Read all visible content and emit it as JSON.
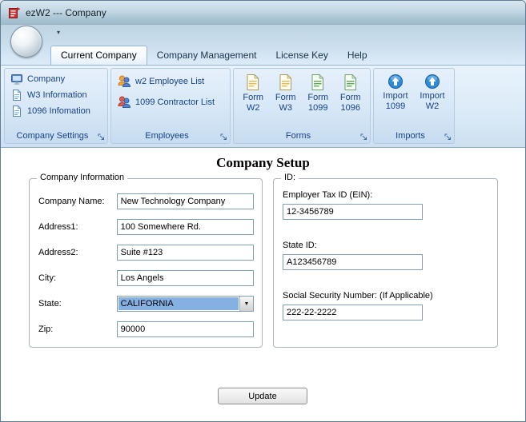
{
  "window": {
    "title": "ezW2 --- Company"
  },
  "qat": {
    "dropdown_icon": "▾"
  },
  "tabs": [
    {
      "label": "Current Company"
    },
    {
      "label": "Company Management"
    },
    {
      "label": "License Key"
    },
    {
      "label": "Help"
    }
  ],
  "ribbon": {
    "groups": [
      {
        "label": "Company Settings",
        "items": [
          {
            "label": "Company",
            "icon": "company-icon"
          },
          {
            "label": "W3 Information",
            "icon": "w3-document-icon"
          },
          {
            "label": "1096 Infomation",
            "icon": "1096-document-icon"
          }
        ]
      },
      {
        "label": "Employees",
        "items": [
          {
            "label": "w2 Employee List",
            "icon": "people-icon"
          },
          {
            "label": "1099 Contractor List",
            "icon": "people-icon"
          }
        ]
      },
      {
        "label": "Forms",
        "items": [
          {
            "line1": "Form",
            "line2": "W2",
            "icon": "form-yellow-icon"
          },
          {
            "line1": "Form",
            "line2": "W3",
            "icon": "form-yellow-icon"
          },
          {
            "line1": "Form",
            "line2": "1099",
            "icon": "form-green-icon"
          },
          {
            "line1": "Form",
            "line2": "1096",
            "icon": "form-green-icon"
          }
        ]
      },
      {
        "label": "Imports",
        "items": [
          {
            "line1": "Import",
            "line2": "1099",
            "icon": "import-circle-icon"
          },
          {
            "line1": "Import",
            "line2": "W2",
            "icon": "import-circle-icon"
          }
        ]
      }
    ]
  },
  "content": {
    "title": "Company Setup",
    "company_info": {
      "legend": "Company Information",
      "fields": [
        {
          "label": "Company Name:",
          "value": "New Technology Company"
        },
        {
          "label": "Address1:",
          "value": "100 Somewhere Rd."
        },
        {
          "label": "Address2:",
          "value": "Suite #123"
        },
        {
          "label": "City:",
          "value": "Los Angels"
        },
        {
          "label": "State:",
          "value": "CALIFORNIA"
        },
        {
          "label": "Zip:",
          "value": "90000"
        }
      ]
    },
    "ids": {
      "legend": "ID:",
      "fields": [
        {
          "label": "Employer Tax ID (EIN):",
          "value": "12-3456789"
        },
        {
          "label": "State ID:",
          "value": "A123456789"
        },
        {
          "label": "Social Security Number: (If Applicable)",
          "value": "222-22-2222"
        }
      ]
    },
    "update_button": "Update",
    "combo_arrow": "▼"
  },
  "colors": {
    "ribbon_text_blue": "#15428b",
    "combo_selection_blue": "#86b0e2",
    "titlebar_blue": "#c3d8e4"
  }
}
